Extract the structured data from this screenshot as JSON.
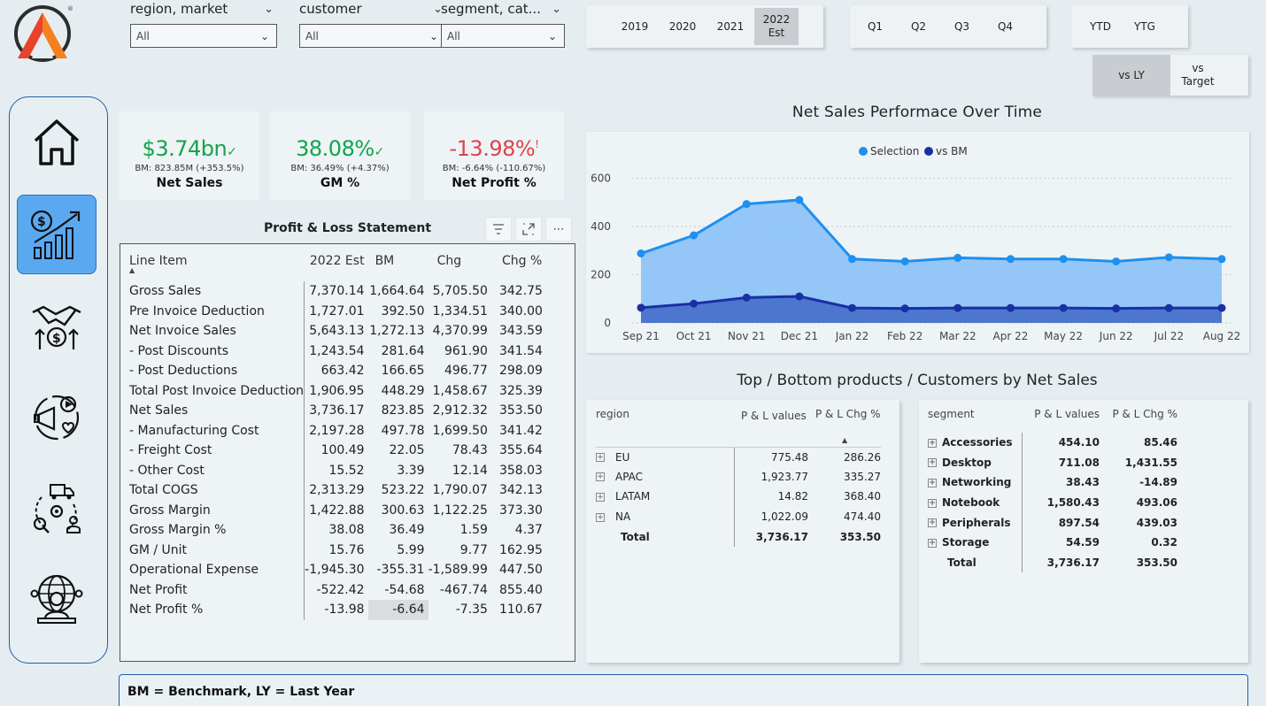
{
  "slicers": [
    {
      "title": "region, market",
      "value": "All"
    },
    {
      "title": "customer",
      "value": "All"
    },
    {
      "title": "segment, cat...",
      "value": "All"
    }
  ],
  "year_buttons": [
    {
      "label": "2019",
      "active": false
    },
    {
      "label": "2020",
      "active": false
    },
    {
      "label": "2021",
      "active": false
    },
    {
      "label": "2022 Est",
      "active": true
    }
  ],
  "quarter_buttons": [
    "Q1",
    "Q2",
    "Q3",
    "Q4"
  ],
  "ytd_buttons": [
    "YTD",
    "YTG"
  ],
  "compare_buttons": [
    {
      "label": "vs LY",
      "active": true
    },
    {
      "label": "vs Target",
      "active": false
    }
  ],
  "nav": [
    {
      "name": "home-icon",
      "active": false
    },
    {
      "name": "finance-growth-icon",
      "active": true
    },
    {
      "name": "sales-handshake-icon",
      "active": false
    },
    {
      "name": "marketing-icon",
      "active": false
    },
    {
      "name": "supply-chain-icon",
      "active": false
    },
    {
      "name": "executive-globe-icon",
      "active": false
    }
  ],
  "kpis": [
    {
      "value": "$3.74bn",
      "mark": "✓",
      "status": "good",
      "sub": "BM: 823.85M (+353.5%)",
      "label": "Net Sales"
    },
    {
      "value": "38.08%",
      "mark": "✓",
      "status": "good",
      "sub": "BM: 36.49% (+4.37%)",
      "label": "GM %"
    },
    {
      "value": "-13.98%",
      "mark": "!",
      "status": "bad",
      "sub": "BM: -6.64% (-110.67%)",
      "label": "Net Profit %"
    }
  ],
  "pl": {
    "title": "Profit & Loss Statement",
    "headers": [
      "Line Item",
      "2022 Est",
      "BM",
      "Chg",
      "Chg %"
    ],
    "rows": [
      [
        "Gross Sales",
        "7,370.14",
        "1,664.64",
        "5,705.50",
        "342.75"
      ],
      [
        "Pre Invoice Deduction",
        "1,727.01",
        "392.50",
        "1,334.51",
        "340.00"
      ],
      [
        "Net Invoice Sales",
        "5,643.13",
        "1,272.13",
        "4,370.99",
        "343.59"
      ],
      [
        "- Post Discounts",
        "1,243.54",
        "281.64",
        "961.90",
        "341.54"
      ],
      [
        "- Post Deductions",
        "663.42",
        "166.65",
        "496.77",
        "298.09"
      ],
      [
        "Total Post Invoice Deduction",
        "1,906.95",
        "448.29",
        "1,458.67",
        "325.39"
      ],
      [
        "Net Sales",
        "3,736.17",
        "823.85",
        "2,912.32",
        "353.50"
      ],
      [
        "- Manufacturing Cost",
        "2,197.28",
        "497.78",
        "1,699.50",
        "341.42"
      ],
      [
        "- Freight Cost",
        "100.49",
        "22.05",
        "78.43",
        "355.64"
      ],
      [
        "- Other Cost",
        "15.52",
        "3.39",
        "12.14",
        "358.03"
      ],
      [
        "Total COGS",
        "2,313.29",
        "523.22",
        "1,790.07",
        "342.13"
      ],
      [
        "Gross Margin",
        "1,422.88",
        "300.63",
        "1,122.25",
        "373.30"
      ],
      [
        "Gross Margin %",
        "38.08",
        "36.49",
        "1.59",
        "4.37"
      ],
      [
        "GM / Unit",
        "15.76",
        "5.99",
        "9.77",
        "162.95"
      ],
      [
        "Operational Expense",
        "-1,945.30",
        "-355.31",
        "-1,589.99",
        "447.50"
      ],
      [
        "Net Profit",
        "-522.42",
        "-54.68",
        "-467.74",
        "855.40"
      ],
      [
        "Net Profit %",
        "-13.98",
        "-6.64",
        "-7.35",
        "110.67"
      ]
    ]
  },
  "chart_title": "Net Sales Performace Over Time",
  "chart_data": {
    "type": "area",
    "categories": [
      "Sep 21",
      "Oct 21",
      "Nov 21",
      "Dec 21",
      "Jan 22",
      "Feb 22",
      "Mar 22",
      "Apr 22",
      "May 22",
      "Jun 22",
      "Jul 22",
      "Aug 22"
    ],
    "series": [
      {
        "name": "Selection",
        "color": "#1f8ff0",
        "values": [
          288,
          363,
          493,
          510,
          265,
          255,
          270,
          265,
          265,
          255,
          272,
          265
        ]
      },
      {
        "name": "vs BM",
        "color": "#1a2fa3",
        "values": [
          63,
          80,
          105,
          110,
          62,
          60,
          62,
          62,
          62,
          60,
          62,
          62
        ]
      }
    ],
    "yticks": [
      0,
      200,
      400,
      600
    ],
    "ylim": [
      0,
      620
    ],
    "legend": "top-center",
    "grid": true
  },
  "topbottom_title": "Top / Bottom products / Customers by Net Sales",
  "region_table": {
    "headers": [
      "region",
      "P & L values",
      "P & L Chg %"
    ],
    "rows": [
      [
        "EU",
        "775.48",
        "286.26"
      ],
      [
        "APAC",
        "1,923.77",
        "335.27"
      ],
      [
        "LATAM",
        "14.82",
        "368.40"
      ],
      [
        "NA",
        "1,022.09",
        "474.40"
      ]
    ],
    "total": [
      "Total",
      "3,736.17",
      "353.50"
    ]
  },
  "segment_table": {
    "headers": [
      "segment",
      "P & L values",
      "P & L Chg %"
    ],
    "rows": [
      [
        "Accessories",
        "454.10",
        "85.46"
      ],
      [
        "Desktop",
        "711.08",
        "1,431.55"
      ],
      [
        "Networking",
        "38.43",
        "-14.89"
      ],
      [
        "Notebook",
        "1,580.43",
        "493.06"
      ],
      [
        "Peripherals",
        "897.54",
        "439.03"
      ],
      [
        "Storage",
        "54.59",
        "0.32"
      ]
    ],
    "total": [
      "Total",
      "3,736.17",
      "353.50"
    ]
  },
  "footer": "BM = Benchmark, LY = Last Year"
}
